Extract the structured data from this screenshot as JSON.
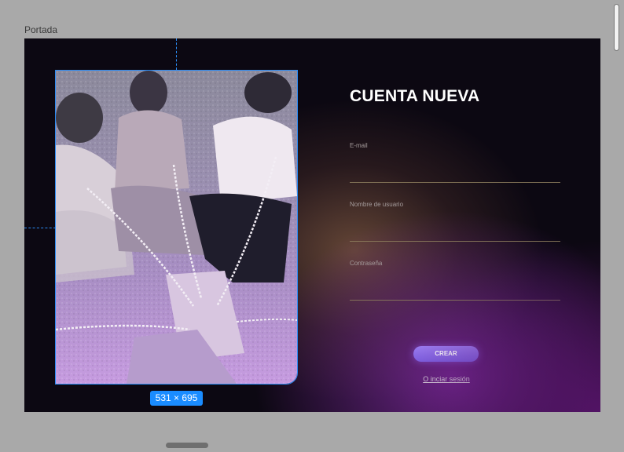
{
  "frame": {
    "label": "Portada"
  },
  "selection": {
    "size_badge": "531 × 695"
  },
  "form": {
    "title": "CUENTA NUEVA",
    "fields": [
      {
        "label": "E-mail",
        "value": ""
      },
      {
        "label": "Nombre  de usuario",
        "value": ""
      },
      {
        "label": "Contraseña",
        "value": ""
      }
    ],
    "create_button": "CREAR",
    "login_link": "O inciar sesión"
  },
  "colors": {
    "selection_blue": "#2b8cf5",
    "button_purple": "#8b6cec",
    "canvas_dark": "#0c0812"
  }
}
